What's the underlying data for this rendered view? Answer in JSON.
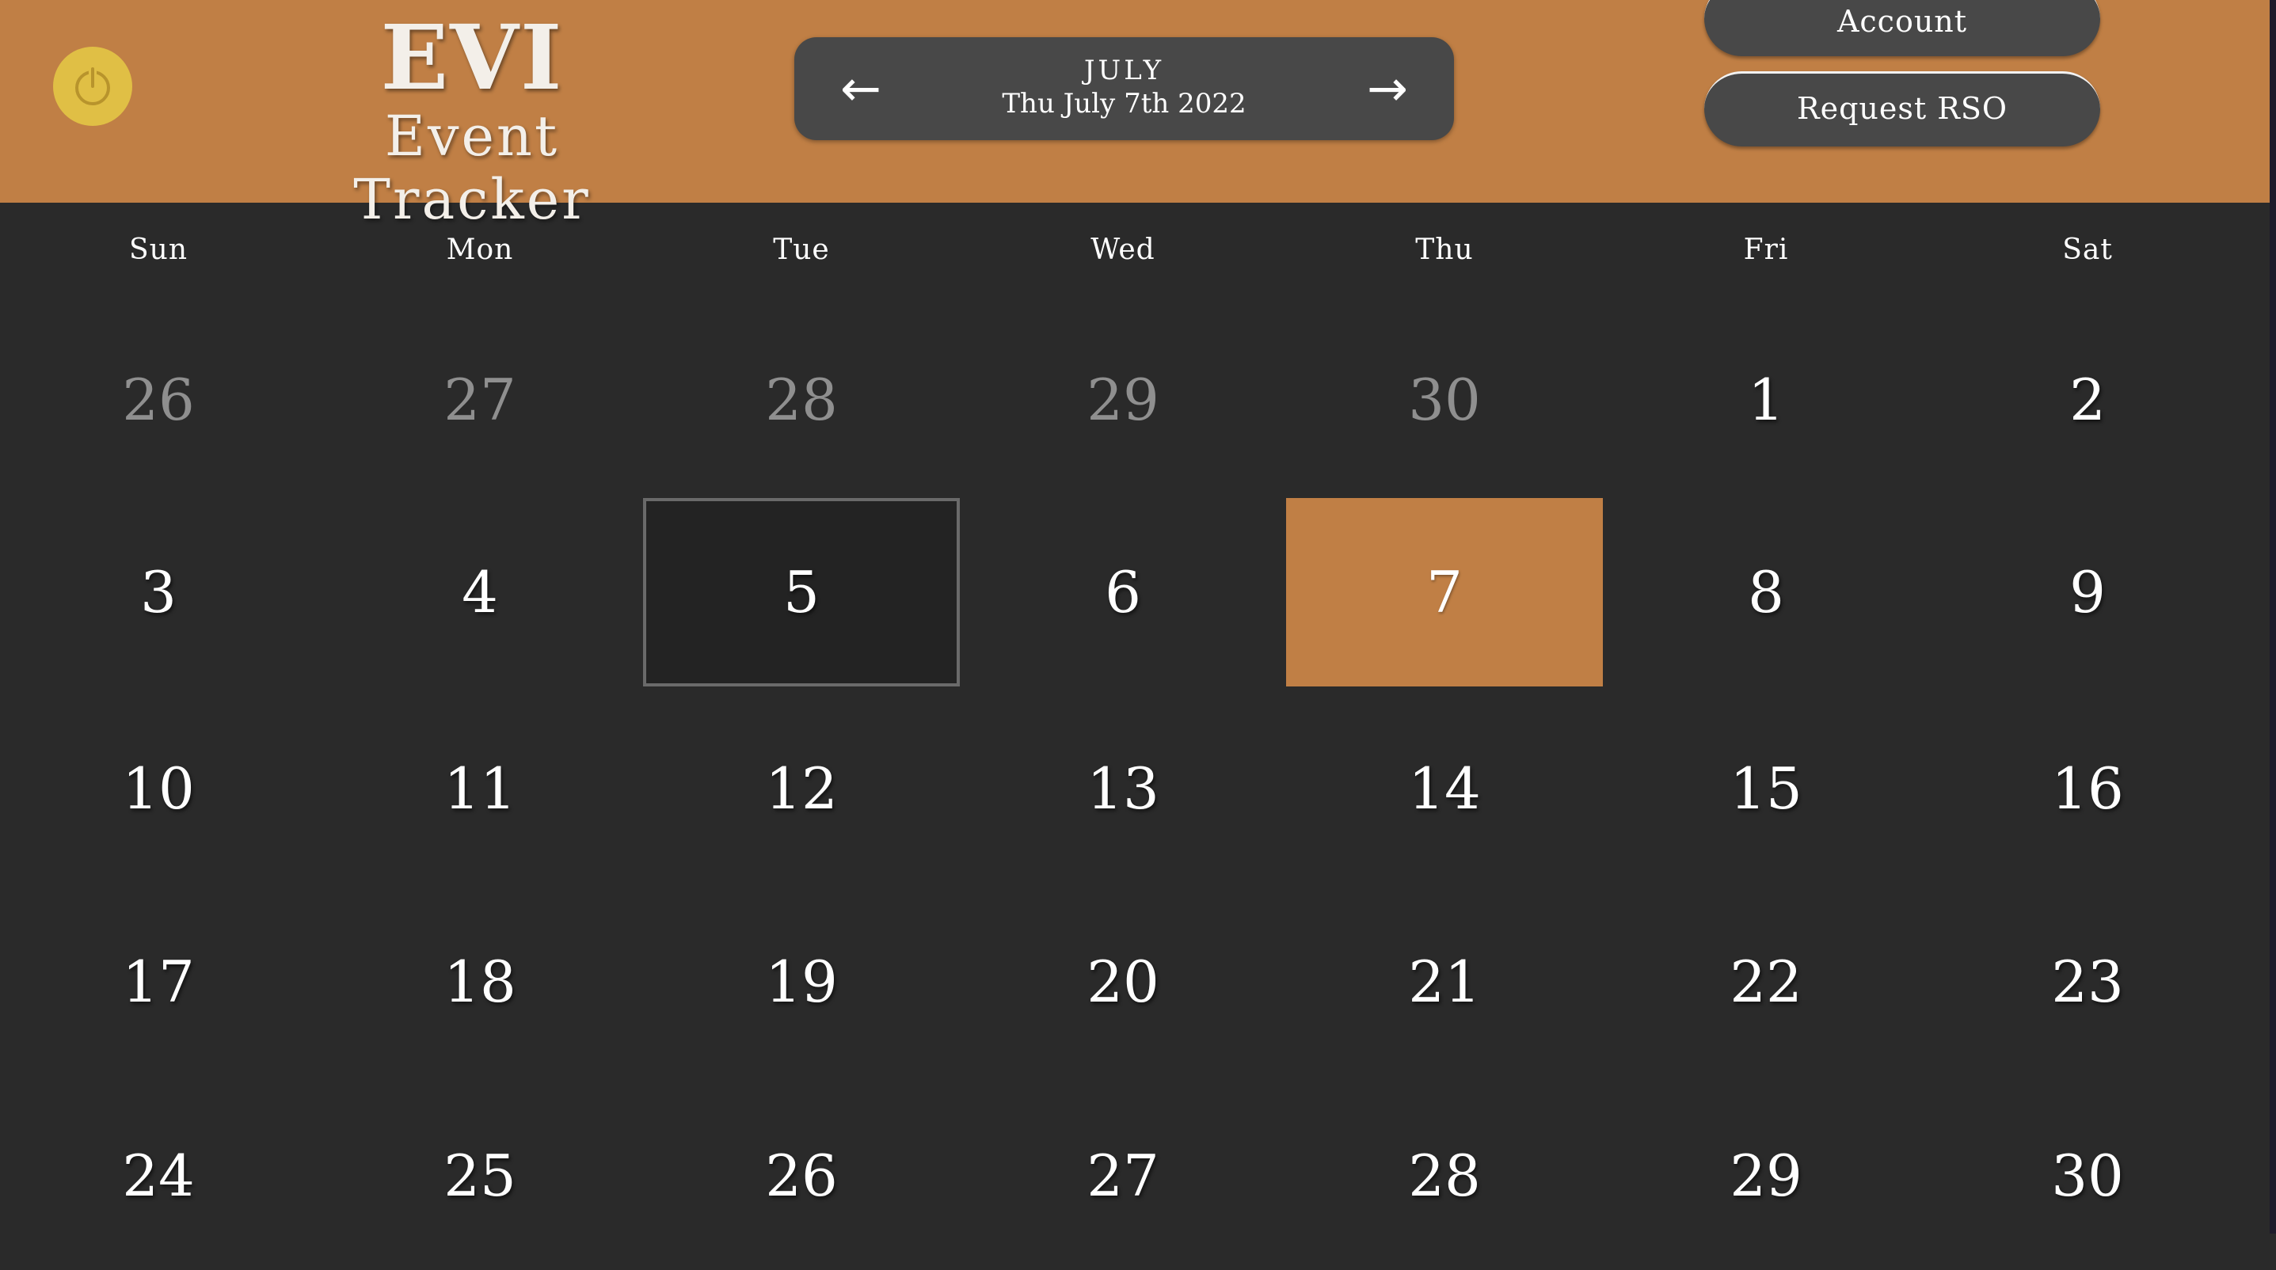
{
  "header": {
    "brand_title": "EVI",
    "brand_subtitle": "Event Tracker",
    "power_icon": "power-icon",
    "month_label": "JULY",
    "date_label": "Thu July 7th 2022",
    "prev_arrow": "←",
    "next_arrow": "→",
    "account_label": "Account",
    "request_rso_label": "Request RSO"
  },
  "colors": {
    "header_bg": "#c07f45",
    "page_bg": "#2a2a2a",
    "power_button": "#e0bf45",
    "nav_bg": "#484848",
    "today_bg": "#c07f45"
  },
  "calendar": {
    "weekdays": [
      "Sun",
      "Mon",
      "Tue",
      "Wed",
      "Thu",
      "Fri",
      "Sat"
    ],
    "today": "7",
    "selected": "5",
    "weeks": [
      [
        {
          "day": "26",
          "muted": true
        },
        {
          "day": "27",
          "muted": true
        },
        {
          "day": "28",
          "muted": true
        },
        {
          "day": "29",
          "muted": true
        },
        {
          "day": "30",
          "muted": true
        },
        {
          "day": "1",
          "muted": false
        },
        {
          "day": "2",
          "muted": false
        }
      ],
      [
        {
          "day": "3",
          "muted": false
        },
        {
          "day": "4",
          "muted": false
        },
        {
          "day": "5",
          "muted": false,
          "state": "selected"
        },
        {
          "day": "6",
          "muted": false
        },
        {
          "day": "7",
          "muted": false,
          "state": "today"
        },
        {
          "day": "8",
          "muted": false
        },
        {
          "day": "9",
          "muted": false
        }
      ],
      [
        {
          "day": "10",
          "muted": false
        },
        {
          "day": "11",
          "muted": false
        },
        {
          "day": "12",
          "muted": false
        },
        {
          "day": "13",
          "muted": false
        },
        {
          "day": "14",
          "muted": false
        },
        {
          "day": "15",
          "muted": false
        },
        {
          "day": "16",
          "muted": false
        }
      ],
      [
        {
          "day": "17",
          "muted": false
        },
        {
          "day": "18",
          "muted": false
        },
        {
          "day": "19",
          "muted": false
        },
        {
          "day": "20",
          "muted": false
        },
        {
          "day": "21",
          "muted": false
        },
        {
          "day": "22",
          "muted": false
        },
        {
          "day": "23",
          "muted": false
        }
      ],
      [
        {
          "day": "24",
          "muted": false
        },
        {
          "day": "25",
          "muted": false
        },
        {
          "day": "26",
          "muted": false
        },
        {
          "day": "27",
          "muted": false
        },
        {
          "day": "28",
          "muted": false
        },
        {
          "day": "29",
          "muted": false
        },
        {
          "day": "30",
          "muted": false
        }
      ]
    ]
  }
}
